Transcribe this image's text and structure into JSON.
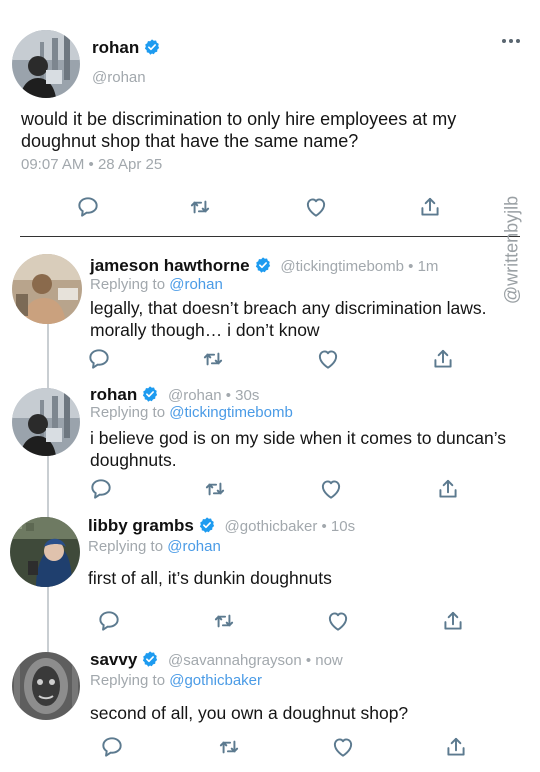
{
  "colors": {
    "accent": "#4a9be6",
    "verified": "#1d9bf0",
    "muted": "#a2a8ad",
    "thread_line": "#c9ced2"
  },
  "more_icon": "more-horizontal-icon",
  "main_post": {
    "name": "rohan",
    "handle": "@rohan",
    "text": "would it be discrimination to only hire employees at my doughnut shop that have the same name?",
    "timestamp": "09:07 AM • 28 Apr 25"
  },
  "watermark": "@writtenbyjlb",
  "replies": [
    {
      "name": "jameson hawthorne",
      "meta": "@tickingtimebomb • 1m",
      "replying_prefix": "Replying to ",
      "replying_to": "@rohan",
      "text": "legally, that doesn’t breach any discrimination laws. morally though… i don’t know"
    },
    {
      "name": "rohan",
      "meta": "@rohan • 30s",
      "replying_prefix": "Replying to ",
      "replying_to": "@tickingtimebomb",
      "text": "i believe god is on my side when it comes to duncan’s doughnuts."
    },
    {
      "name": "libby grambs",
      "meta": "@gothicbaker • 10s",
      "replying_prefix": "Replying to ",
      "replying_to": "@rohan",
      "text": "first of all, it’s dunkin doughnuts"
    },
    {
      "name": "savvy",
      "meta": "@savannahgrayson • now",
      "replying_prefix": "Replying to ",
      "replying_to": "@gothicbaker",
      "text": "second of all, you own a doughnut shop?"
    }
  ],
  "action_icons": [
    "comment-icon",
    "retweet-icon",
    "like-icon",
    "share-icon"
  ]
}
